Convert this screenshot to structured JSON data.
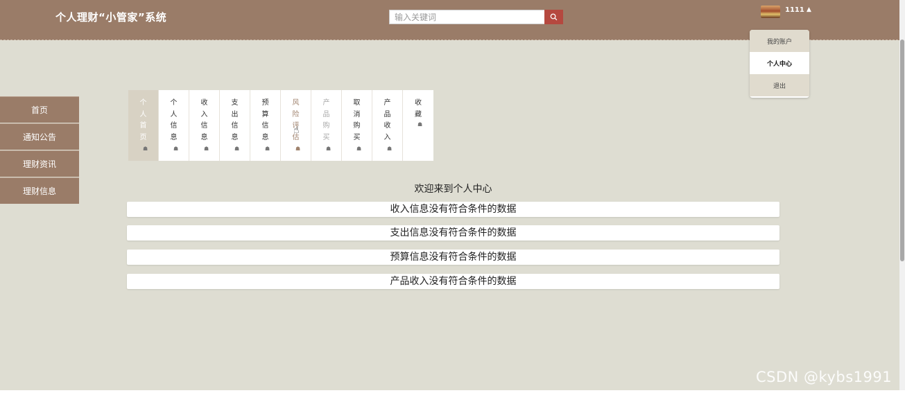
{
  "header": {
    "site_title": "个人理财“小管家”系统",
    "search_placeholder": "输入关键词",
    "username": "1111"
  },
  "user_menu": {
    "items": [
      "我的账户",
      "个人中心",
      "退出"
    ]
  },
  "sidebar": {
    "items": [
      "首页",
      "通知公告",
      "理财资讯",
      "理财信息"
    ]
  },
  "tabs": [
    {
      "label": "个人首页"
    },
    {
      "label": "个人信息"
    },
    {
      "label": "收入信息"
    },
    {
      "label": "支出信息"
    },
    {
      "label": "预算信息"
    },
    {
      "label": "风险评估"
    },
    {
      "label": "产品购买"
    },
    {
      "label": "取消购买"
    },
    {
      "label": "产品收入"
    },
    {
      "label": "收藏"
    }
  ],
  "main": {
    "welcome": "欢迎来到个人中心",
    "notices": [
      "收入信息没有符合条件的数据",
      "支出信息没有符合条件的数据",
      "预算信息没有符合条件的数据",
      "产品收入没有符合条件的数据"
    ]
  },
  "watermark": "CSDN @kybs1991",
  "colors": {
    "header_bg": "#9a7c68",
    "page_bg": "#deddd2",
    "search_button": "#b5483f"
  }
}
